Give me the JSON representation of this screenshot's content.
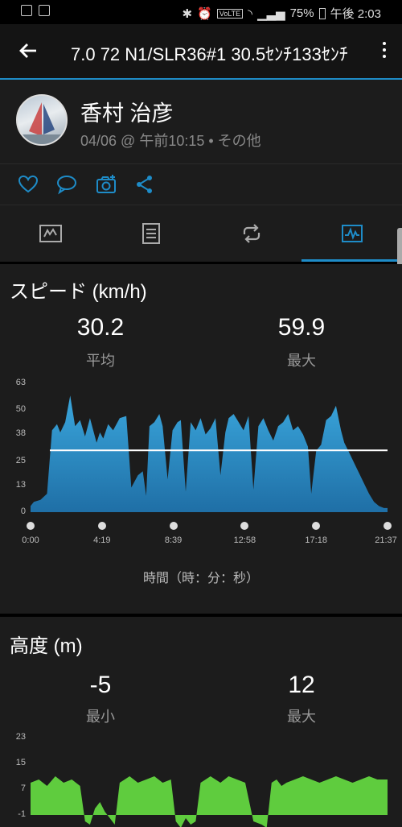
{
  "status_bar": {
    "battery": "75%",
    "time": "午後 2:03",
    "network_badge": "VoLTE"
  },
  "app_bar": {
    "title": "7.0 72 N1/SLR36#1 30.5ｾﾝﾁ133ｾﾝﾁ"
  },
  "profile": {
    "name": "香村 治彦",
    "meta": "04/06 @ 午前10:15 • その他"
  },
  "actions": [
    "heart-icon",
    "comment-icon",
    "camera-add-icon",
    "share-icon"
  ],
  "tabs": [
    "overview-tab-icon",
    "details-tab-icon",
    "laps-tab-icon",
    "charts-tab-icon"
  ],
  "colors": {
    "accent": "#1e8cc8",
    "speed_fill": "#3aa6dc",
    "elevation_fill": "#5fcc3e"
  },
  "speed": {
    "title": "スピード (km/h)",
    "avg_value": "30.2",
    "avg_label": "平均",
    "max_value": "59.9",
    "max_label": "最大",
    "x_axis_title": "時間（時：分：秒）"
  },
  "elevation": {
    "title": "高度 (m)",
    "min_value": "-5",
    "min_label": "最小",
    "max_value": "12",
    "max_label": "最大"
  },
  "chart_data": [
    {
      "type": "area",
      "title": "スピード (km/h)",
      "xlabel": "時間（時：分：秒）",
      "x_ticks": [
        "0:00",
        "4:19",
        "8:39",
        "12:58",
        "17:18",
        "21:37"
      ],
      "y_ticks": [
        "0",
        "13",
        "25",
        "38",
        "50",
        "63"
      ],
      "ylim": [
        0,
        63
      ],
      "xlim_minutes": [
        0,
        21.62
      ],
      "average_line": 30.2,
      "series": [
        {
          "x_minutes": [
            0,
            0.2,
            0.6,
            1.0,
            1.3,
            1.6,
            1.8,
            2.1,
            2.4,
            2.7,
            3.0,
            3.3,
            3.6,
            4.0,
            4.2,
            4.4,
            4.7,
            5.0,
            5.4,
            5.8,
            6.1,
            6.5,
            6.8,
            7.0,
            7.2,
            7.5,
            7.8,
            8.0,
            8.3,
            8.6,
            8.9,
            9.1,
            9.4,
            9.7,
            10.0,
            10.3,
            10.6,
            10.9,
            11.2,
            11.5,
            11.8,
            12.0,
            12.3,
            12.6,
            12.9,
            13.2,
            13.5,
            13.8,
            14.1,
            14.4,
            14.7,
            15.0,
            15.3,
            15.6,
            15.9,
            16.2,
            16.5,
            16.8,
            17.0,
            17.3,
            17.6,
            17.9,
            18.2,
            18.5,
            18.8,
            19.0,
            19.3,
            19.6,
            19.9,
            20.2,
            20.5,
            20.8,
            21.1,
            21.4,
            21.62
          ],
          "values": [
            3,
            5,
            6,
            9,
            40,
            43,
            39,
            44,
            57,
            42,
            45,
            37,
            46,
            34,
            39,
            36,
            43,
            40,
            46,
            47,
            12,
            18,
            20,
            8,
            42,
            44,
            48,
            42,
            16,
            40,
            44,
            45,
            10,
            44,
            40,
            46,
            38,
            41,
            46,
            18,
            39,
            46,
            48,
            44,
            40,
            47,
            11,
            42,
            46,
            40,
            35,
            42,
            44,
            48,
            40,
            42,
            38,
            32,
            9,
            30,
            33,
            45,
            47,
            52,
            40,
            34,
            29,
            24,
            19,
            14,
            9,
            5,
            3,
            2,
            2
          ]
        }
      ]
    },
    {
      "type": "area",
      "title": "高度 (m)",
      "y_ticks": [
        "-1",
        "7",
        "15",
        "23"
      ],
      "ylim": [
        -5,
        23
      ],
      "x_minutes": [
        0,
        0.5,
        1.0,
        1.5,
        2.0,
        2.5,
        3.0,
        3.3,
        3.6,
        3.9,
        4.2,
        4.5,
        4.8,
        5.1,
        5.4,
        5.7,
        6.0,
        6.5,
        7.0,
        7.5,
        8.0,
        8.5,
        8.8,
        9.1,
        9.4,
        9.7,
        10.0,
        10.3,
        10.6,
        10.9,
        11.2,
        11.5,
        12.0,
        12.5,
        13.0,
        13.5,
        14.0,
        14.3,
        14.6,
        14.9,
        15.2,
        15.5,
        16.0,
        16.5,
        17.0,
        17.5,
        18.0,
        18.5,
        19.0,
        19.5,
        20.0,
        20.5,
        21.0,
        21.62
      ],
      "values": [
        9,
        10,
        8,
        11,
        9,
        10,
        8,
        -3,
        -4,
        1,
        3,
        0,
        -2,
        -4,
        9,
        10,
        11,
        9,
        10,
        11,
        9,
        10,
        -3,
        -5,
        -2,
        -4,
        -3,
        9,
        10,
        11,
        10,
        9,
        11,
        10,
        9,
        -3,
        -4,
        -5,
        9,
        10,
        8,
        9,
        10,
        11,
        10,
        9,
        10,
        11,
        10,
        9,
        10,
        11,
        10,
        10
      ]
    }
  ]
}
